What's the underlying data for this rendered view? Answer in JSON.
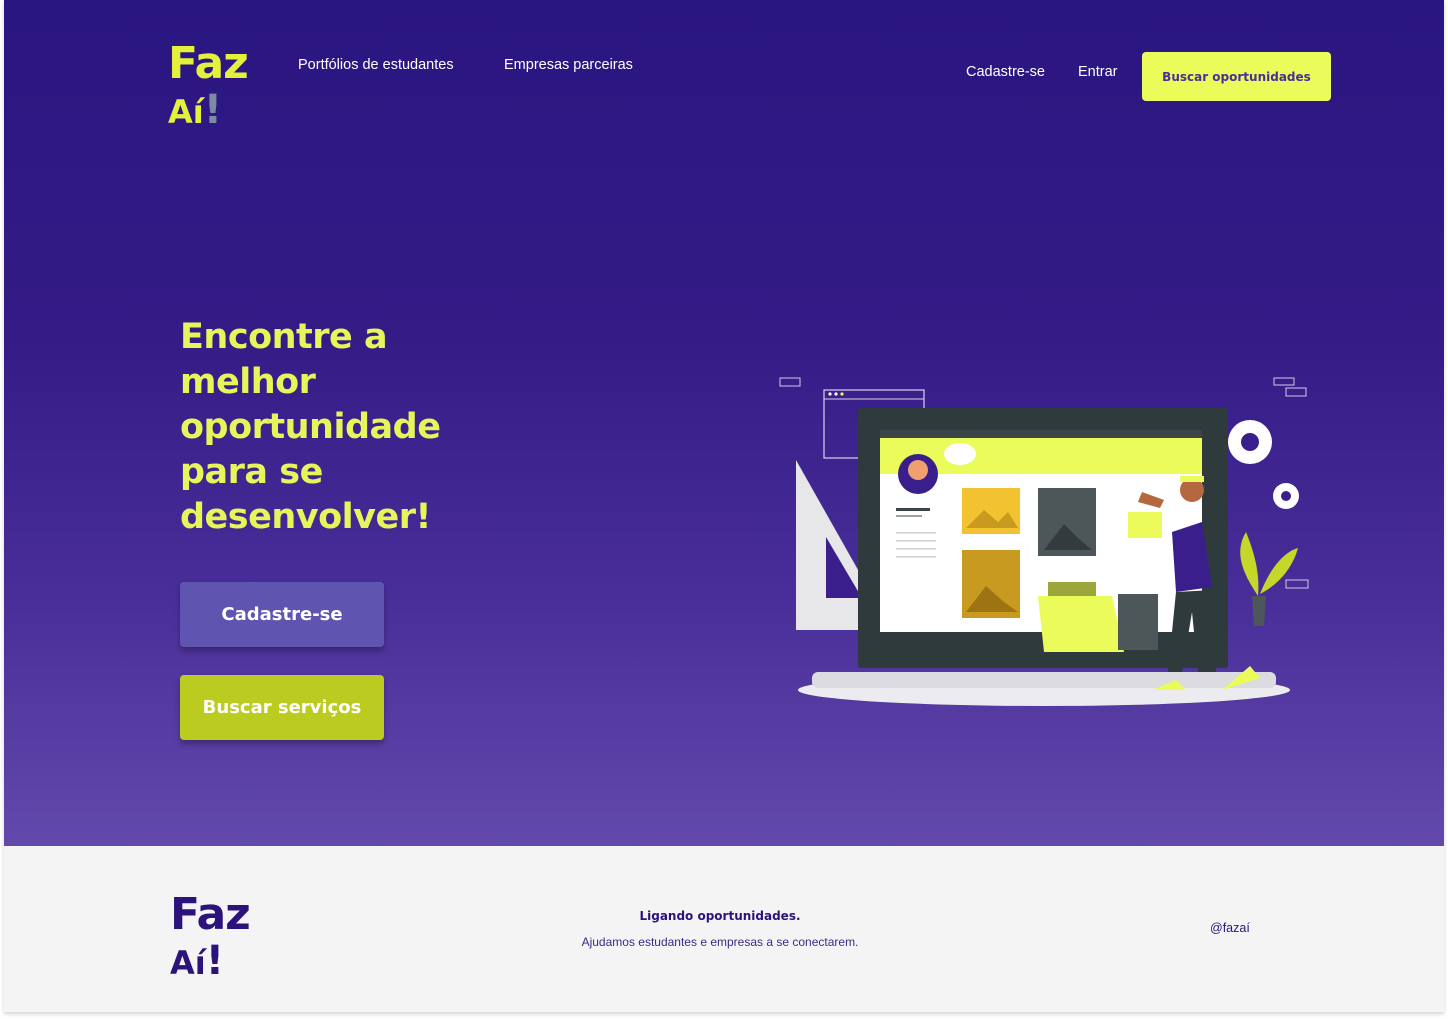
{
  "colors": {
    "brand_dark": "#2c137b",
    "accent_yellow": "#eafb5a",
    "headline_yellow": "#e6f65a",
    "signup_button": "#5f55b0",
    "services_button": "#bccb1f",
    "footer_bg": "#f4f4f4"
  },
  "header": {
    "logo_line1": "Faz",
    "logo_line2": "Aí",
    "logo_mark": "!",
    "nav": {
      "portfolios": "Portfólios de estudantes",
      "companies": "Empresas parceiras",
      "signup": "Cadastre-se",
      "login": "Entrar"
    },
    "cta": "Buscar oportunidades"
  },
  "hero": {
    "headline_lines": [
      "Encontre a",
      "melhor",
      "oportunidade",
      "para se",
      "desenvolver!"
    ],
    "signup_button": "Cadastre-se",
    "services_button": "Buscar serviços",
    "illustration_icon": "portfolio-laptop-illustration"
  },
  "footer": {
    "logo_line1": "Faz",
    "logo_line2": "Aí",
    "logo_mark": "!",
    "tagline": "Ligando oportunidades.",
    "subtagline": "Ajudamos estudantes e empresas a se conectarem.",
    "handle": "@fazaí"
  }
}
